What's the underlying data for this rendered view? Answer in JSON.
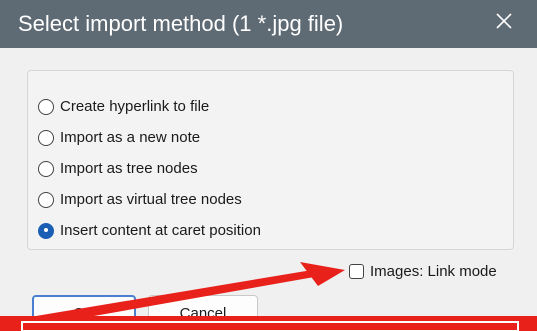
{
  "dialog": {
    "title": "Select import method (1 *.jpg file)",
    "close_icon": "close-icon"
  },
  "options": [
    {
      "label": "Create hyperlink to file",
      "checked": false
    },
    {
      "label": "Import as a new note",
      "checked": false
    },
    {
      "label": "Import as tree nodes",
      "checked": false
    },
    {
      "label": "Import as virtual tree nodes",
      "checked": false
    },
    {
      "label": "Insert content at caret position",
      "checked": true
    }
  ],
  "images_link_mode": {
    "label": "Images: Link mode",
    "checked": false
  },
  "buttons": {
    "ok_label": "OK",
    "cancel_label": "Cancel"
  },
  "colors": {
    "titlebar": "#5f6b74",
    "accent": "#1b5fb5",
    "annotation": "#e8221b"
  }
}
